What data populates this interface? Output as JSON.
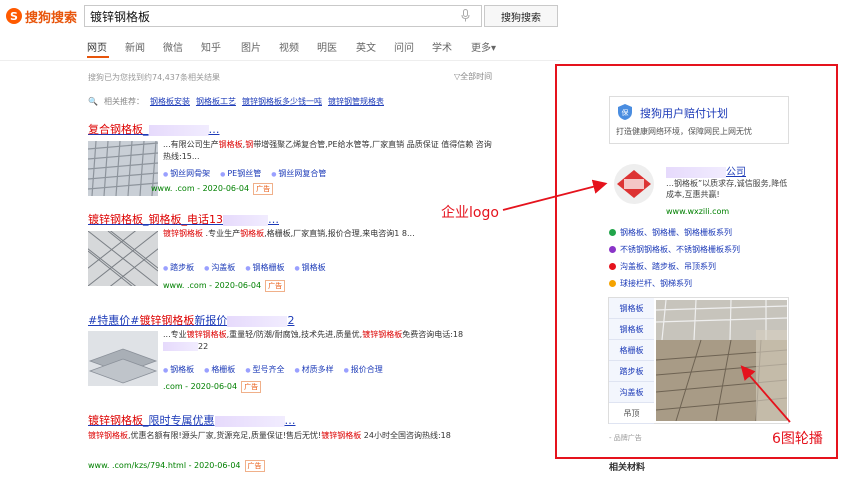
{
  "brand": {
    "name": "搜狗搜索"
  },
  "search": {
    "query": "镀锌钢格板",
    "button": "搜狗搜索"
  },
  "tabs": [
    "网页",
    "新闻",
    "微信",
    "知乎",
    "图片",
    "视频",
    "明医",
    "英文",
    "问问",
    "学术",
    "更多▾"
  ],
  "stat": "搜狗已为您找到约74,437条相关结果",
  "all_time": "全部时间",
  "related": {
    "label": "相关推荐：",
    "items": [
      "钢格板安装",
      "钢格板工艺",
      "镀锌钢格板多少钱一吨",
      "镀锌钢管规格表"
    ]
  },
  "results": [
    {
      "title_parts": [
        "复合钢格板",
        "_",
        "…"
      ],
      "snippet": [
        "...有限公司生产",
        "钢格板",
        ",",
        "钢",
        "带增强聚乙烯复合管,PE给水管等,厂家直销 品质保证 值得信赖 咨询热线:15..."
      ],
      "subs": [
        "钢丝网骨架",
        "PE钢丝管",
        "钢丝网复合管"
      ],
      "url": "www.              .com - 2020-06-04",
      "ad": "广告"
    },
    {
      "title_parts": [
        "镀锌钢格板",
        "_",
        "钢格板_电话13",
        "…"
      ],
      "snippet": [
        "镀锌钢格板",
        " .专业生产",
        "钢格板",
        ",格栅板,厂家直销,报价合理,来电咨询1 8..."
      ],
      "subs": [
        "踏步板",
        "沟盖板",
        "钢格栅板",
        "钢格板"
      ],
      "url": "www.             .com - 2020-06-04",
      "ad": "广告"
    },
    {
      "title_parts": [
        "#特惠价#",
        "镀锌钢格板",
        "新报价",
        "…",
        "2"
      ],
      "snippet": [
        "...专业",
        "镀锌钢格板",
        ",重量轻/防潮/耐腐蚀,技术先进,质量优,",
        "镀锌钢格板",
        "免费咨询电话:18",
        "22"
      ],
      "subs": [
        "钢格板",
        "格栅板",
        "型号齐全",
        "材质多样",
        "报价合理"
      ],
      "url": "              .com - 2020-06-04",
      "ad": "广告"
    },
    {
      "title_parts": [
        "镀锌钢格板",
        "_限时专属优惠",
        "…"
      ],
      "snippet": [
        "镀锌钢格板",
        ",优惠名额有限!源头厂家,货源充足,质量保证!售后无忧!",
        "镀锌钢格板",
        " 24小时全国咨询热线:18"
      ],
      "subs": [],
      "url": "www.           .com/kzs/794.html - 2020-06-04",
      "ad": "广告"
    }
  ],
  "side": {
    "promo_title": "搜狗用户赔付计划",
    "promo_desc": "打造健康网络环境，保障网民上网无忧",
    "company_name_suffix": "公司",
    "company_desc": "…钢格板”以质求存,诚信服务,降低成本,互惠共赢!",
    "company_url": "www.wxzili.com",
    "categories": [
      {
        "text": "钢格板、钢格栅、钢格栅板系列",
        "color": "#21a44a"
      },
      {
        "text": "不锈钢钢格板、不锈钢格栅板系列",
        "color": "#8a35c8"
      },
      {
        "text": "沟盖板、踏步板、吊顶系列",
        "color": "#e5131d"
      },
      {
        "text": "球接栏杆、钢梯系列",
        "color": "#f5a300"
      }
    ],
    "carousel_tabs": [
      "钢格板",
      "钢格板",
      "格栅板",
      "踏步板",
      "沟盖板",
      "吊顶"
    ],
    "brand_ad": "- 品牌广告",
    "related_title": "相关材料"
  },
  "annotations": {
    "logo": "企业logo",
    "carousel": "6图轮播"
  },
  "colors": {
    "accent": "#e8550b",
    "link": "#1d3bb8",
    "annotation": "#e5131d",
    "url": "#008000"
  }
}
